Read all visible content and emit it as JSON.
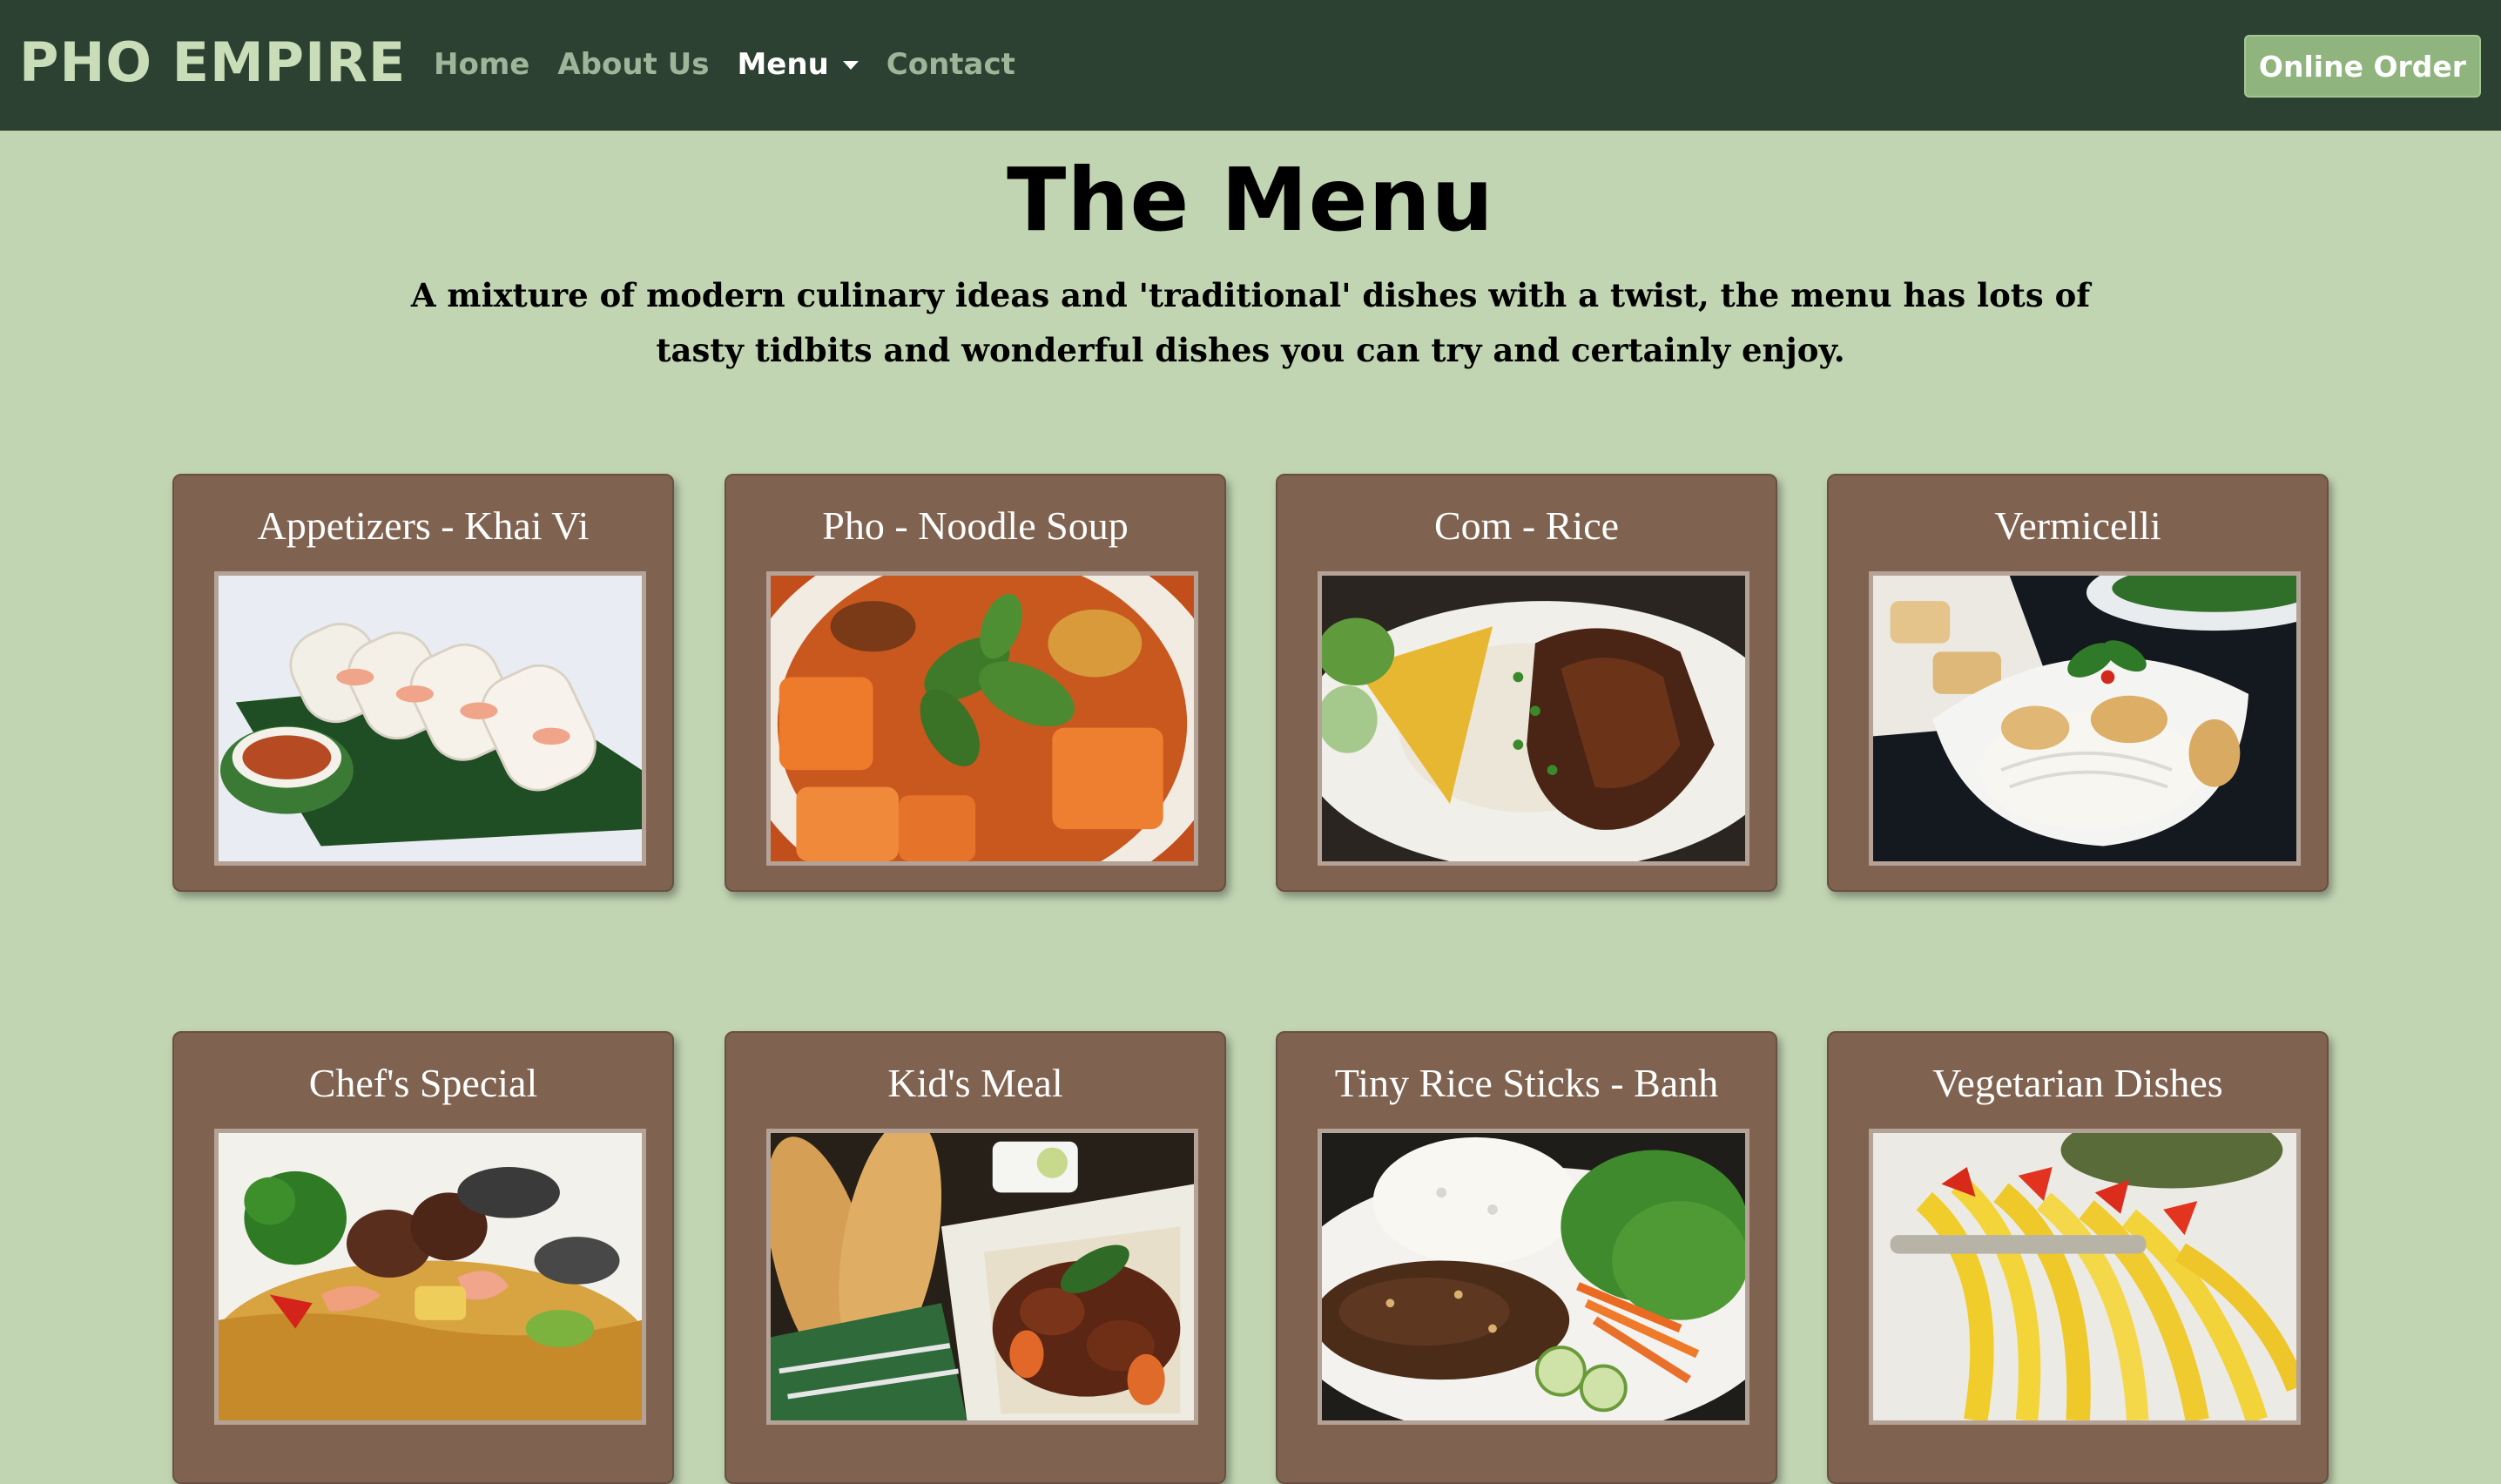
{
  "navbar": {
    "brand": "PHO EMPIRE",
    "links": [
      {
        "label": "Home"
      },
      {
        "label": "About Us"
      },
      {
        "label": "Menu"
      },
      {
        "label": "Contact"
      }
    ],
    "order_button": "Online Order"
  },
  "main": {
    "title": "The Menu",
    "intro": "A mixture of modern culinary ideas and 'traditional' dishes with a twist, the menu has lots of tasty tidbits and wonderful dishes you can try and certainly enjoy."
  },
  "cards": [
    {
      "title": "Appetizers - Khai Vi"
    },
    {
      "title": "Pho - Noodle Soup"
    },
    {
      "title": "Com - Rice"
    },
    {
      "title": "Vermicelli"
    },
    {
      "title": "Chef's Special"
    },
    {
      "title": "Kid's Meal"
    },
    {
      "title": "Tiny Rice Sticks - Banh"
    },
    {
      "title": "Vegetarian Dishes"
    }
  ],
  "colors": {
    "navbar_bg": "#2c4131",
    "page_bg": "#c2d5b3",
    "card_bg": "#7f6350",
    "order_button_bg": "#8fb47d"
  }
}
